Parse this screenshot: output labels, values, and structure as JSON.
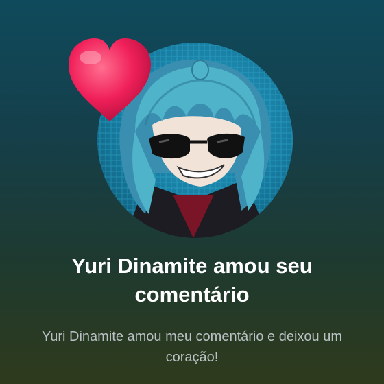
{
  "notification": {
    "title": "Yuri Dinamite amou seu comentário",
    "message": "Yuri Dinamite amou meu comentário e deixou um coração!"
  },
  "icons": {
    "heart": "heart-icon",
    "avatar": "user-avatar"
  },
  "colors": {
    "heart": "#f0205a",
    "title_text": "#ffffff",
    "message_text": "#b9c1c4",
    "avatar_hair": "#4fb3c9"
  }
}
